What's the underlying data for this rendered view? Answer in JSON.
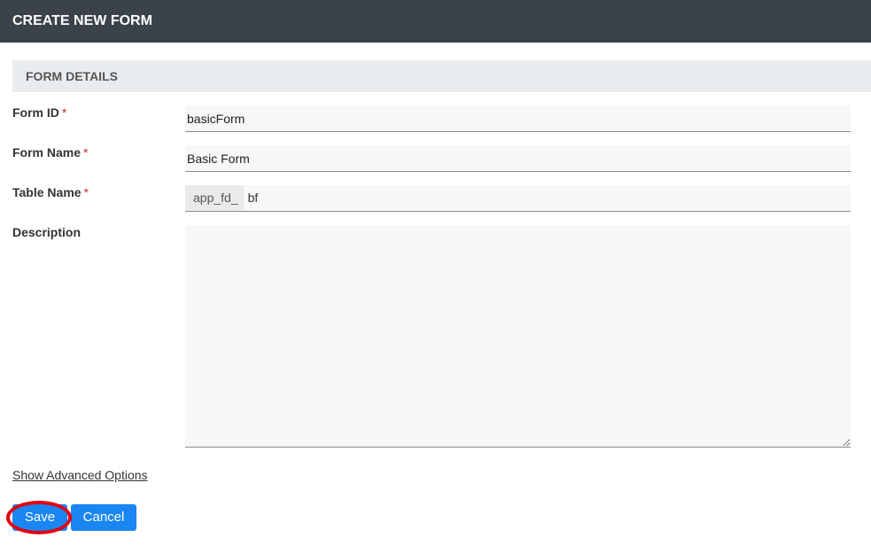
{
  "header": {
    "title": "CREATE NEW FORM"
  },
  "section": {
    "title": "FORM DETAILS"
  },
  "fields": {
    "form_id": {
      "label": "Form ID",
      "required_mark": "*",
      "value": "basicForm"
    },
    "form_name": {
      "label": "Form Name",
      "required_mark": "*",
      "value": "Basic Form"
    },
    "table_name": {
      "label": "Table Name",
      "required_mark": "*",
      "prefix": "app_fd_",
      "value": "bf"
    },
    "description": {
      "label": "Description",
      "value": ""
    }
  },
  "links": {
    "advanced": "Show Advanced Options"
  },
  "buttons": {
    "save": "Save",
    "cancel": "Cancel"
  },
  "colors": {
    "header_bg": "#3b4249",
    "button_bg": "#1a86f2",
    "highlight": "#e3000f"
  }
}
